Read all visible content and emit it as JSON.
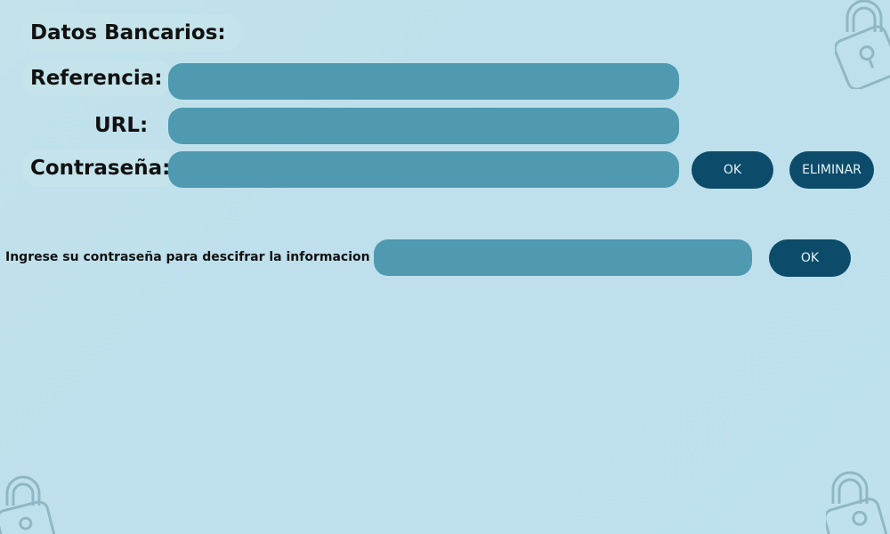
{
  "form": {
    "title": "Datos Bancarios:",
    "fields": {
      "referencia_label": "Referencia:",
      "url_label": "URL:",
      "contrasena_label": "Contraseña:",
      "referencia_value": "",
      "url_value": "",
      "contrasena_value": ""
    },
    "ok_label": "OK",
    "eliminar_label": "ELIMINAR"
  },
  "decrypt": {
    "prompt": "Ingrese su contraseña para descifrar la informacion",
    "password_value": "",
    "ok_label": "OK"
  },
  "colors": {
    "background": "#bfe1ec",
    "field": "#4f99b1",
    "button": "#0c4c6a",
    "label_pill": "#c4e3ea",
    "lock_outline": "#8fb8c4"
  },
  "icons": [
    "lock-icon"
  ]
}
